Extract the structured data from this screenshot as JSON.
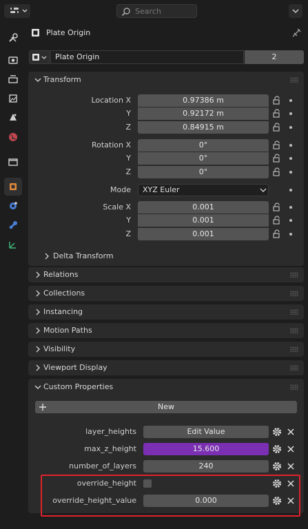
{
  "header": {
    "search_placeholder": "Search"
  },
  "object": {
    "title": "Plate Origin",
    "datablock_name": "Plate Origin",
    "user_count": "2"
  },
  "transform": {
    "header": "Transform",
    "location_label": "Location X",
    "y_label": "Y",
    "z_label": "Z",
    "location": [
      "0.97386 m",
      "0.92172 m",
      "0.84915 m"
    ],
    "rotation_label": "Rotation X",
    "rotation": [
      "0°",
      "0°",
      "0°"
    ],
    "mode_label": "Mode",
    "mode_value": "XYZ Euler",
    "scale_label": "Scale X",
    "scale": [
      "0.001",
      "0.001",
      "0.001"
    ],
    "delta_label": "Delta Transform"
  },
  "panels": {
    "relations": "Relations",
    "collections": "Collections",
    "instancing": "Instancing",
    "motion_paths": "Motion Paths",
    "visibility": "Visibility",
    "viewport_display": "Viewport Display",
    "custom_properties": "Custom Properties"
  },
  "custom_props": {
    "new_label": "New",
    "items": [
      {
        "name": "layer_heights",
        "value": "Edit Value"
      },
      {
        "name": "max_z_height",
        "value": "15.600"
      },
      {
        "name": "number_of_layers",
        "value": "240"
      },
      {
        "name": "override_height",
        "value": ""
      },
      {
        "name": "override_height_value",
        "value": "0.000"
      }
    ]
  },
  "colors": {
    "accent_purple": "#7b2fb3",
    "highlight_red": "#e0232c",
    "active_tab_orange": "#e08a3a"
  }
}
